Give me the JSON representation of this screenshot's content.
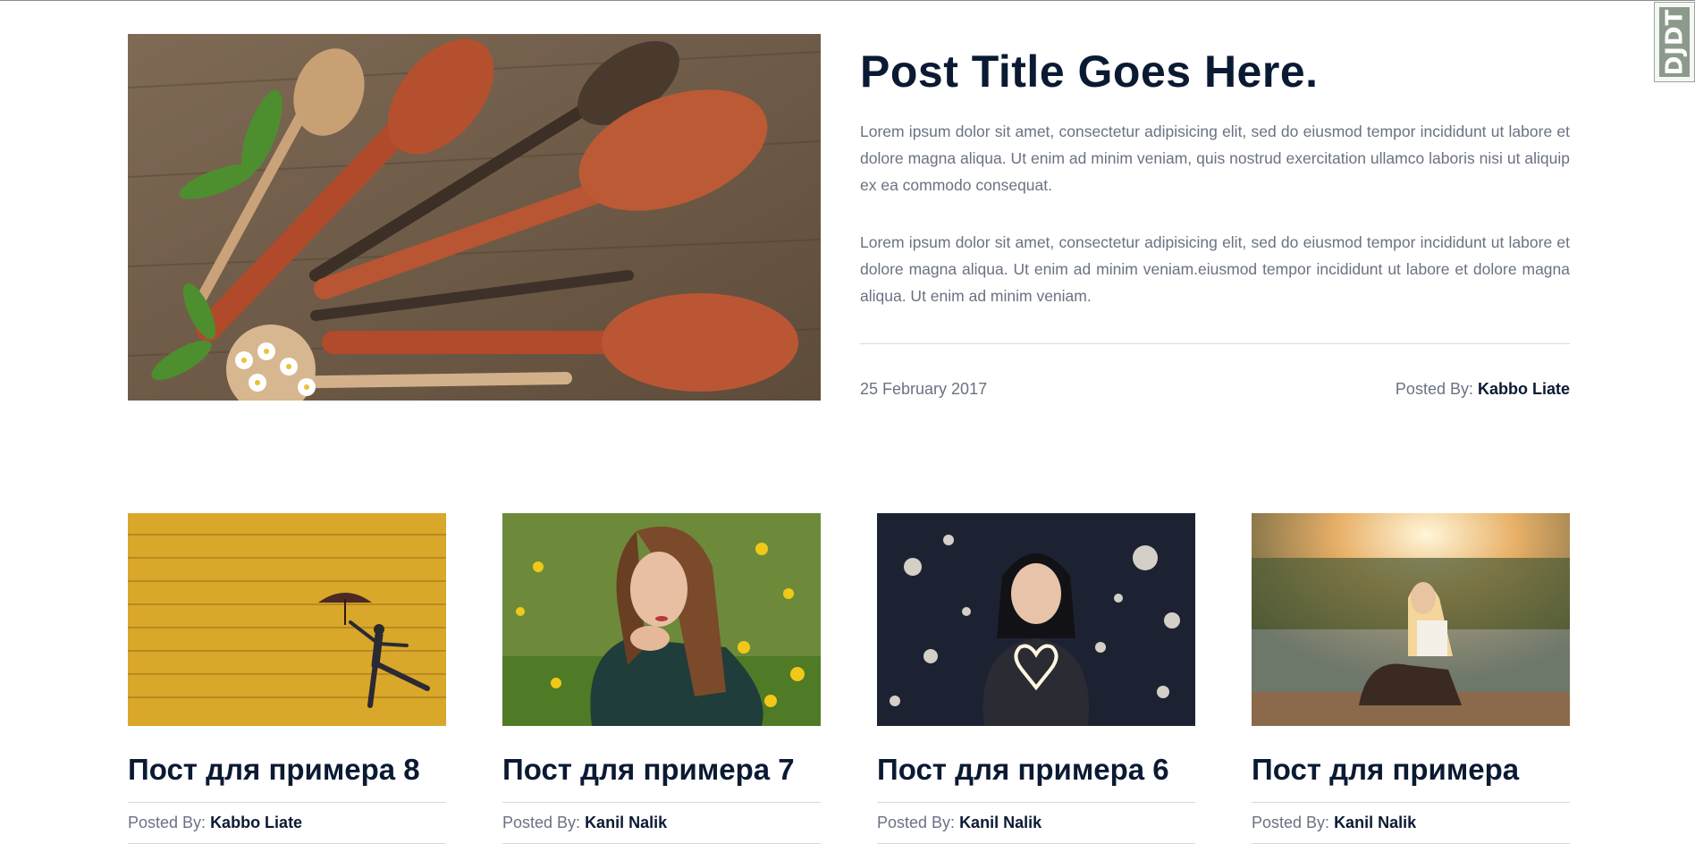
{
  "featured": {
    "title": "Post Title Goes Here.",
    "paragraphs": [
      "Lorem ipsum dolor sit amet, consectetur adipisicing elit, sed do eiusmod tempor incididunt ut labore et dolore magna aliqua. Ut enim ad minim veniam, quis nostrud exercitation ullamco laboris nisi ut aliquip ex ea commodo consequat.",
      "Lorem ipsum dolor sit amet, consectetur adipisicing elit, sed do eiusmod tempor incididunt ut labore et dolore magna aliqua. Ut enim ad minim veniam.eiusmod tempor incididunt ut labore et dolore magna aliqua. Ut enim ad minim veniam."
    ],
    "date": "25 February 2017",
    "posted_by_label": "Posted By:",
    "author": "Kabbo Liate"
  },
  "posts": [
    {
      "title": "Пост для примера 8",
      "posted_by_label": "Posted By:",
      "author": "Kabbo Liate"
    },
    {
      "title": "Пост для примера 7",
      "posted_by_label": "Posted By:",
      "author": "Kanil Nalik"
    },
    {
      "title": "Пост для примера 6",
      "posted_by_label": "Posted By:",
      "author": "Kanil Nalik"
    },
    {
      "title": "Пост для примера",
      "posted_by_label": "Posted By:",
      "author": "Kanil Nalik"
    }
  ],
  "debug_toolbar": {
    "label": "DJDT"
  },
  "colors": {
    "heading": "#0b1a33",
    "muted": "#6a7282",
    "rule": "#d6dae0"
  }
}
